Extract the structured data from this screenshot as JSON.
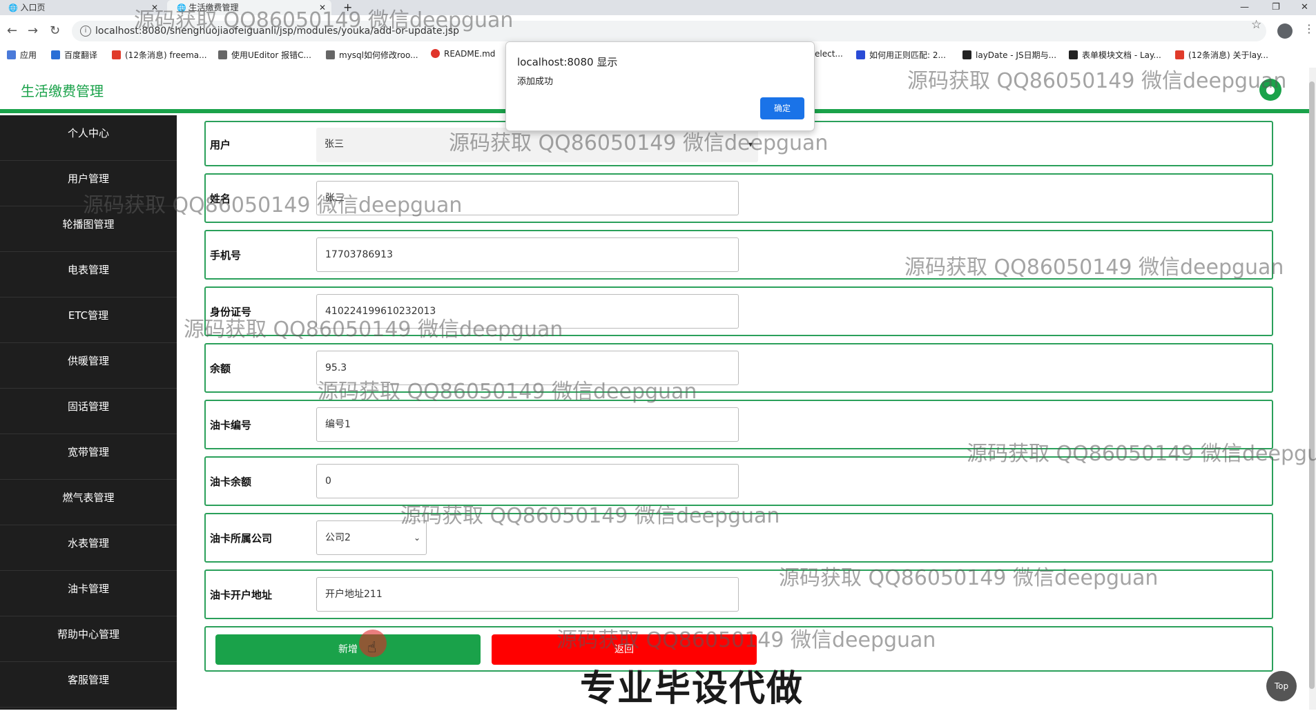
{
  "browser": {
    "tabs": [
      {
        "label": "入口页"
      },
      {
        "label": "生活缴费管理"
      }
    ],
    "url": "localhost:8080/shenghuojiaofeiguanli/jsp/modules/youka/add-or-update.jsp",
    "bookmarks": [
      {
        "label": "应用",
        "color": "#555"
      },
      {
        "label": "百度翻译",
        "color": "#2a6fd6"
      },
      {
        "label": "(12条消息) freema...",
        "color": "#e03b2a"
      },
      {
        "label": "使用UEditor 报错C...",
        "color": "#444"
      },
      {
        "label": "mysql如何修改roo...",
        "color": "#444"
      },
      {
        "label": "README.md",
        "color": "#e0342a"
      },
      {
        "label": "elect...",
        "color": "#444"
      },
      {
        "label": "如何用正则匹配: 2...",
        "color": "#2a4bd6"
      },
      {
        "label": "layDate - JS日期与...",
        "color": "#222"
      },
      {
        "label": "表单模块文档 - Lay...",
        "color": "#222"
      },
      {
        "label": "(12条消息) 关于lay...",
        "color": "#e03b2a"
      }
    ]
  },
  "header": {
    "title": "生活缴费管理",
    "accent": "#1aa24a"
  },
  "sidebar": {
    "items": [
      {
        "label": "个人中心"
      },
      {
        "label": "用户管理"
      },
      {
        "label": "轮播图管理"
      },
      {
        "label": "电表管理"
      },
      {
        "label": "ETC管理"
      },
      {
        "label": "供暖管理"
      },
      {
        "label": "固话管理"
      },
      {
        "label": "宽带管理"
      },
      {
        "label": "燃气表管理"
      },
      {
        "label": "水表管理"
      },
      {
        "label": "油卡管理"
      },
      {
        "label": "帮助中心管理"
      },
      {
        "label": "客服管理"
      }
    ]
  },
  "form": {
    "user_label": "用户",
    "user_value": "张三",
    "name_label": "姓名",
    "name_value": "张三",
    "phone_label": "手机号",
    "phone_value": "17703786913",
    "idcard_label": "身份证号",
    "idcard_value": "410224199610232013",
    "balance_label": "余额",
    "balance_value": "95.3",
    "card_no_label": "油卡编号",
    "card_no_value": "编号1",
    "card_balance_label": "油卡余额",
    "card_balance_value": "0",
    "company_label": "油卡所属公司",
    "company_value": "公司2",
    "address_label": "油卡开户地址",
    "address_value": "开户地址211",
    "add_button": "新增",
    "back_button": "返回",
    "add_color": "#1aa24a",
    "back_color": "#ff0000"
  },
  "dialog": {
    "title": "localhost:8080 显示",
    "message": "添加成功",
    "ok_label": "确定"
  },
  "top_button": "Top",
  "watermark": "源码获取 QQ86050149 微信deepguan",
  "banner": "专业毕设代做"
}
